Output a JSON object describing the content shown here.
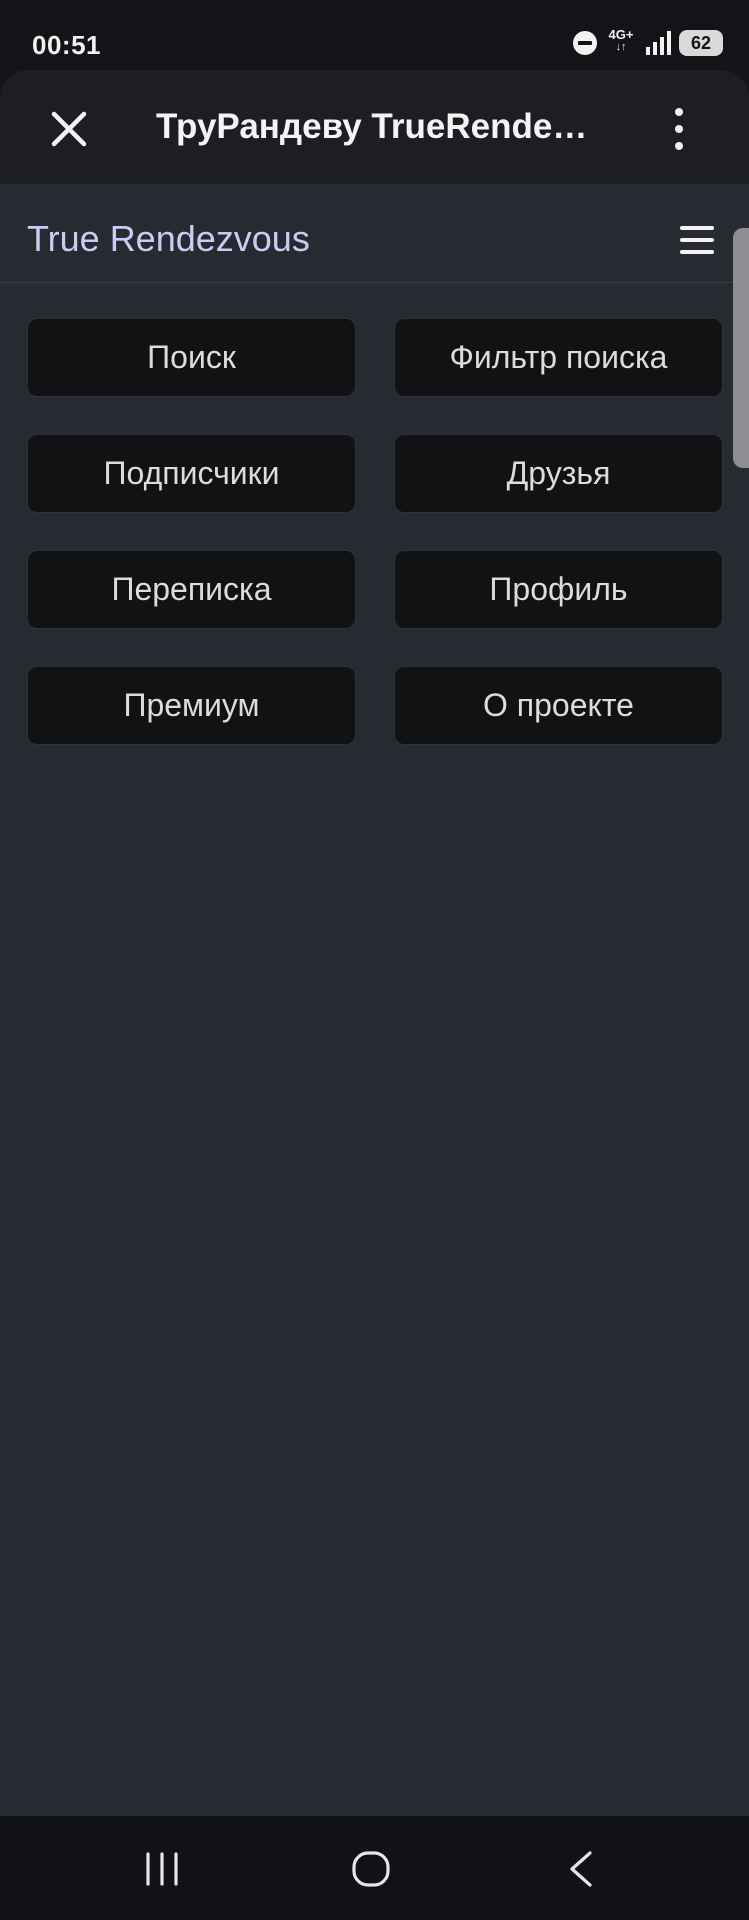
{
  "status_bar": {
    "time": "00:51",
    "network": "4G+",
    "network_arrows": "↓↑",
    "battery": "62"
  },
  "app_bar": {
    "title": "ТруРандеву TrueRendezvous"
  },
  "site": {
    "brand": "True Rendezvous",
    "menu": [
      {
        "label": "Поиск"
      },
      {
        "label": "Фильтр поиска"
      },
      {
        "label": "Подписчики"
      },
      {
        "label": "Друзья"
      },
      {
        "label": "Переписка"
      },
      {
        "label": "Профиль"
      },
      {
        "label": "Премиум"
      },
      {
        "label": "О проекте"
      }
    ]
  },
  "colors": {
    "status_bg": "#131418",
    "app_bar_bg": "#1c1e23",
    "content_bg": "#272a30",
    "button_bg": "#111214",
    "brand_text": "#c9cdf5"
  },
  "icons": {
    "close": "close-icon",
    "more": "more-vertical-icon",
    "menu": "hamburger-menu-icon",
    "dnd": "do-not-disturb-icon",
    "signal": "signal-icon",
    "battery": "battery-icon",
    "recents": "recents-icon",
    "home": "home-icon",
    "back": "back-icon"
  }
}
